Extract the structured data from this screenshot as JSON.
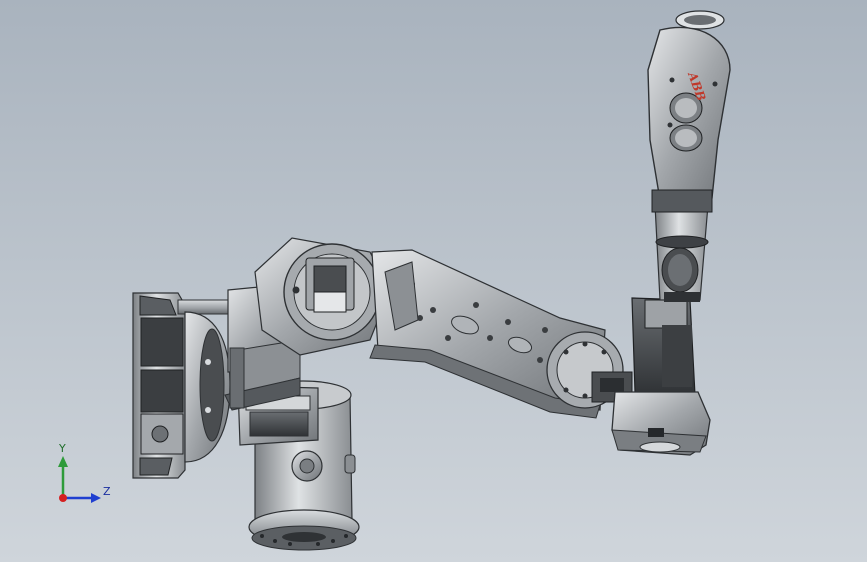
{
  "viewport": {
    "background_top": "#a9b3be",
    "background_bottom": "#cfd5db"
  },
  "model": {
    "brand_logo": "ABB",
    "logo_color": "#c0392b",
    "body_color": "#9a9ea3",
    "dark_color": "#3e4246"
  },
  "triad": {
    "y_label": "Y",
    "z_label": "Z",
    "y_color": "#2e9b3a",
    "z_color": "#1f3fd0",
    "origin_color": "#d42020"
  }
}
